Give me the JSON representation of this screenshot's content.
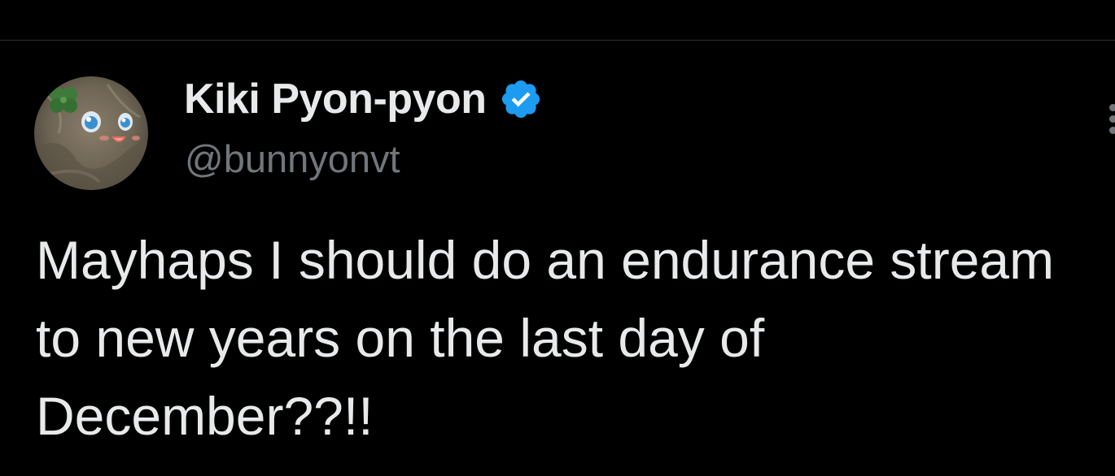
{
  "tweet": {
    "author": {
      "display_name": "Kiki Pyon-pyon",
      "handle": "@bunnyonvt",
      "verified": true
    },
    "text": "Mayhaps I should do an endurance stream to new years on the last day of December??!!"
  },
  "colors": {
    "background": "#000000",
    "text_primary": "#e7e9ea",
    "text_secondary": "#71767b",
    "verified_blue": "#1d9bf0",
    "divider": "#2a2d31"
  },
  "icons": {
    "verified": "verified-badge-icon",
    "more": "more-options-icon"
  }
}
